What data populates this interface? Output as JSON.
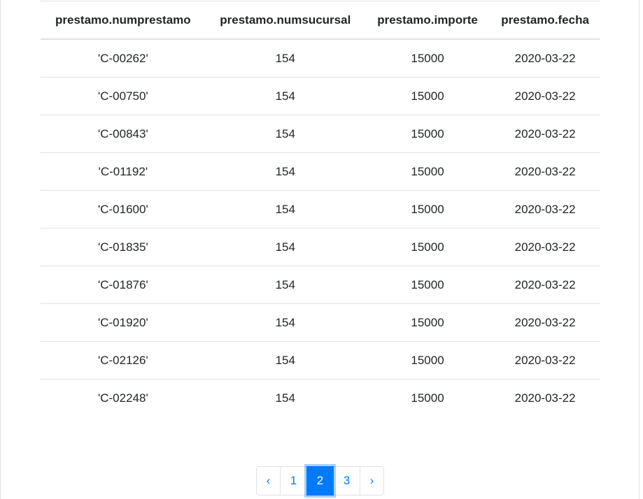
{
  "table": {
    "columns": [
      "prestamo.numprestamo",
      "prestamo.numsucursal",
      "prestamo.importe",
      "prestamo.fecha"
    ],
    "rows": [
      [
        "'C-00262'",
        "154",
        "15000",
        "2020-03-22"
      ],
      [
        "'C-00750'",
        "154",
        "15000",
        "2020-03-22"
      ],
      [
        "'C-00843'",
        "154",
        "15000",
        "2020-03-22"
      ],
      [
        "'C-01192'",
        "154",
        "15000",
        "2020-03-22"
      ],
      [
        "'C-01600'",
        "154",
        "15000",
        "2020-03-22"
      ],
      [
        "'C-01835'",
        "154",
        "15000",
        "2020-03-22"
      ],
      [
        "'C-01876'",
        "154",
        "15000",
        "2020-03-22"
      ],
      [
        "'C-01920'",
        "154",
        "15000",
        "2020-03-22"
      ],
      [
        "'C-02126'",
        "154",
        "15000",
        "2020-03-22"
      ],
      [
        "'C-02248'",
        "154",
        "15000",
        "2020-03-22"
      ]
    ]
  },
  "pagination": {
    "prev_label": "‹",
    "next_label": "›",
    "pages": [
      "1",
      "2",
      "3"
    ],
    "active_page": "2",
    "accent_color": "#007bff"
  }
}
